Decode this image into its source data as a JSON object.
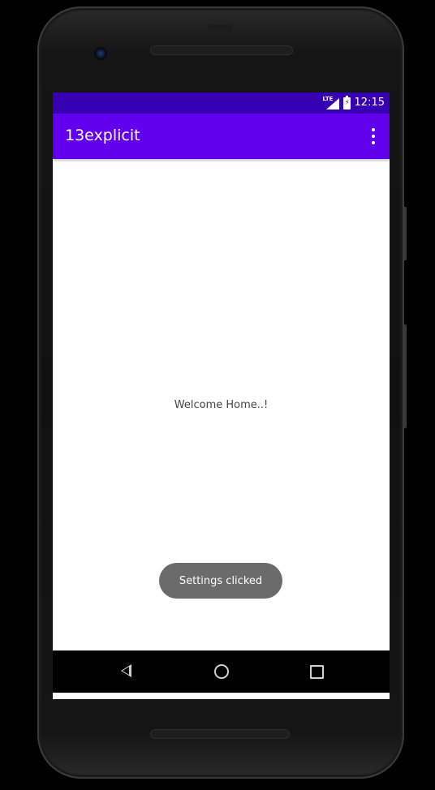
{
  "status_bar": {
    "time": "12:15",
    "network_label": "LTE",
    "icons": [
      "lte-signal-icon",
      "battery-charging-icon"
    ]
  },
  "app_bar": {
    "title": "13explicit",
    "overflow_icon": "more-vert-icon"
  },
  "content": {
    "welcome_text": "Welcome Home..!"
  },
  "toast": {
    "message": "Settings clicked"
  },
  "nav_bar": {
    "icons": [
      "back-icon",
      "home-icon",
      "recents-icon"
    ]
  },
  "colors": {
    "status_bar": "#3700b3",
    "app_bar": "#6200ee",
    "toast": "#6b6b6b",
    "screen_background": "#ffffff"
  }
}
